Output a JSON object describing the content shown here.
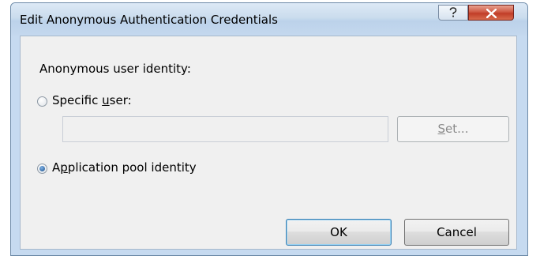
{
  "window": {
    "title": "Edit Anonymous Authentication Credentials"
  },
  "controls": {
    "help_icon": "question-icon",
    "close_icon": "close-x-icon"
  },
  "section_label": "Anonymous user identity:",
  "specific_user": {
    "label_pre": "Specific ",
    "label_accel": "u",
    "label_post": "ser:",
    "checked": false,
    "input_value": "",
    "set_pre": "",
    "set_accel": "S",
    "set_post": "et..."
  },
  "app_pool": {
    "label_pre": "A",
    "label_accel": "p",
    "label_post": "plication pool identity",
    "checked": true
  },
  "buttons": {
    "ok": "OK",
    "cancel": "Cancel"
  }
}
